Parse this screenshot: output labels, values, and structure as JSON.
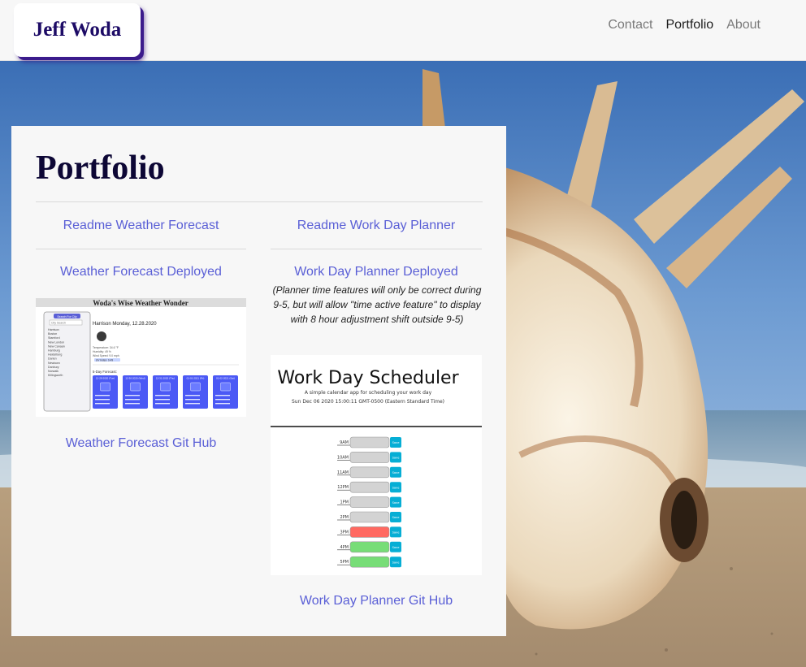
{
  "brand": {
    "name": "Jeff Woda"
  },
  "nav": {
    "links": [
      "Contact",
      "Portfolio",
      "About"
    ],
    "active": "Portfolio"
  },
  "portfolio": {
    "title": "Portfolio",
    "readme_weather": "Readme Weather Forecast",
    "readme_planner": "Readme Work Day Planner",
    "weather_deployed": "Weather Forecast Deployed",
    "planner_deployed": "Work Day Planner Deployed",
    "planner_note": "(Planner time features will only be correct during 9-5, but will allow \"time active feature\" to display with 8 hour adjustment shift outside 9-5)",
    "weather_git": "Weather Forecast Git Hub",
    "planner_git": "Work Day Planner Git Hub"
  },
  "weather_app": {
    "title": "Woda's Wise Weather Wonder",
    "search_button": "Search For City",
    "search_placeholder": "City Search",
    "cities": [
      "Harrison",
      "Boston",
      "Stamford",
      "New London",
      "New Canaan",
      "Hamburg",
      "Heidelberg",
      "Darien",
      "Newtown",
      "Danbury",
      "Norwalk",
      "Killingworth"
    ],
    "city_heading": "Harrison Monday, 12.28.2020",
    "temp": "Temperature: 34.6 °F",
    "humidity": "Humidity: 49 %",
    "wind": "Wind Speed: 9.0 mph",
    "uv": "UV Index: 0.49",
    "forecast_label": "5-Day Forecast:",
    "forecast_days": [
      "12-29-2020 (Tue)",
      "12-30-2020 (Wed)",
      "12-31-2020 (Thu)",
      "01-01-2021 (Fri)",
      "01-02-2021 (Sat)"
    ]
  },
  "planner_app": {
    "title": "Work Day Scheduler",
    "subtitle": "A simple calendar app for scheduling your work day",
    "datetime": "Sun Dec 06 2020 15:00:11 GMT-0500 (Eastern Standard Time)",
    "hours": [
      "9AM",
      "10AM",
      "11AM",
      "12PM",
      "1PM",
      "2PM",
      "3PM",
      "4PM",
      "5PM"
    ],
    "row_states": [
      "past",
      "past",
      "past",
      "past",
      "past",
      "past",
      "present",
      "future",
      "future"
    ],
    "save_label": "Save"
  },
  "colors": {
    "link": "#5a5fd6",
    "brand_text": "#1d0b66",
    "brand_shadow": "#3b1b8c",
    "past": "#d3d3d3",
    "present": "#ff6961",
    "future": "#77dd77",
    "save": "#06aed5",
    "forecast_card": "#4b59f5"
  },
  "icons": {
    "background": "seashell-beach-photo"
  }
}
